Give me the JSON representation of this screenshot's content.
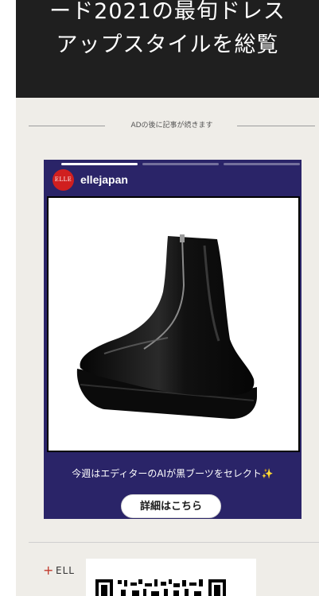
{
  "hero": {
    "title_line1": "ード2021の最旬ドレス",
    "title_line2": "アップスタイルを総覧"
  },
  "ad_notice": "ADの後に記事が続きます",
  "story": {
    "avatar_text": "ELLE",
    "account": "ellejapan",
    "caption": "今週はエディターのAIが黒ブーツをセレクト",
    "caption_emoji": "✨",
    "cta_label": "詳細はこちら",
    "progress_segments": 3,
    "active_segment": 1
  },
  "footer": {
    "plus": "+",
    "label": "ELL"
  },
  "colors": {
    "story_bg": "#2a2468",
    "hero_bg": "#1f1f1f",
    "page_bg": "#efede8",
    "brand_red": "#d01f1f"
  }
}
